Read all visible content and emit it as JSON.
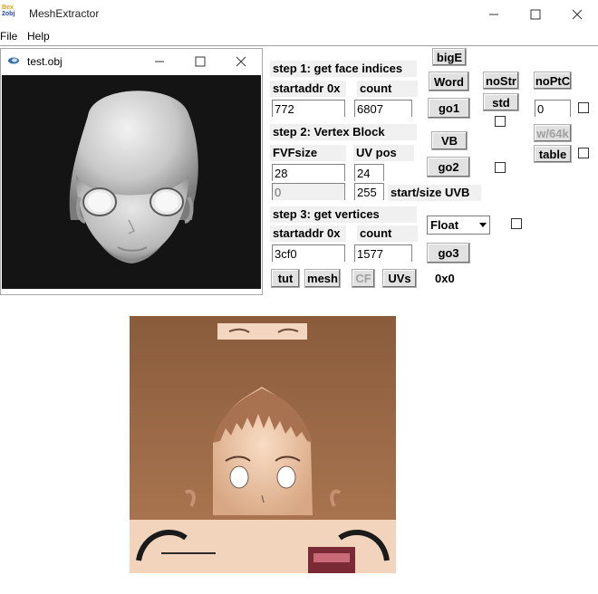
{
  "window": {
    "title": "MeshExtractor",
    "icon_top": "Bex",
    "icon_bottom": "2obj"
  },
  "menu": {
    "file": "File",
    "help": "Help"
  },
  "child": {
    "title": "test.obj"
  },
  "step1": {
    "label": "step 1: get face indices",
    "startaddr_label": "startaddr 0x",
    "count_label": "count",
    "startaddr_value": "772",
    "count_value": "6807"
  },
  "step2": {
    "label": "step 2: Vertex Block",
    "fvfsize_label": "FVFsize",
    "uvpos_label": "UV pos",
    "fvfsize_value": "28",
    "uvpos_value": "24",
    "uvb_start_value": "0",
    "uvb_size_value": "255",
    "uvb_label": "start/size UVB"
  },
  "step3": {
    "label": "step 3: get vertices",
    "startaddr_label": "startaddr 0x",
    "count_label": "count",
    "startaddr_value": "3cf0",
    "count_value": "1577"
  },
  "buttons": {
    "bigE": "bigE",
    "word": "Word",
    "go1": "go1",
    "vb": "VB",
    "go2": "go2",
    "go3": "go3",
    "nostr": "noStr",
    "noptc": "noPtC",
    "std": "std",
    "w64k": "w/64k",
    "table": "table",
    "tut": "tut",
    "mesh": "mesh",
    "cf": "CF",
    "uvs": "UVs"
  },
  "edits": {
    "noptc_value": "0"
  },
  "select": {
    "value": "Float"
  },
  "status": {
    "text": "0x0"
  },
  "colors": {
    "viewport_bg": "#141414",
    "skin": "#e8c4a4",
    "hair": "#8a5c3c"
  }
}
